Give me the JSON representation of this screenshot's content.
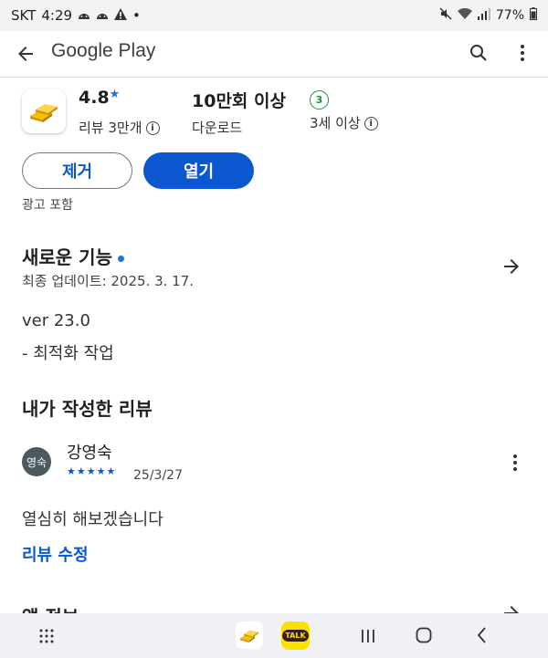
{
  "status_bar": {
    "carrier": "SKT",
    "time": "4:29",
    "dot": "•",
    "battery": "77%"
  },
  "app_bar": {
    "title": "Google Play"
  },
  "app": {
    "rating": "4.8",
    "rating_star": "★",
    "reviews_label": "리뷰 3만개",
    "downloads": "10만회 이상",
    "downloads_label": "다운로드",
    "age_badge": "3",
    "age_label": "3세 이상",
    "info_symbol": "i"
  },
  "buttons": {
    "remove": "제거",
    "open": "열기"
  },
  "ads_label": "광고 포함",
  "whats_new": {
    "title": "새로운 기능",
    "updated": "최종 업데이트: 2025. 3. 17.",
    "version": "ver 23.0",
    "note": "- 최적화 작업"
  },
  "my_review": {
    "title": "내가 작성한 리뷰",
    "avatar_text": "영숙",
    "name": "강영숙",
    "stars": "★★★★★",
    "rating": 5,
    "date": "25/3/27",
    "text": "열심히 해보겠습니다",
    "edit_label": "리뷰 수정"
  },
  "app_info": {
    "title": "앱 정보"
  },
  "nav_bar": {
    "kakao_label": "TALK"
  },
  "colors": {
    "accent_blue": "#0b57d0",
    "badge_green": "#1e8e3e",
    "kakao_yellow": "#fae100"
  }
}
